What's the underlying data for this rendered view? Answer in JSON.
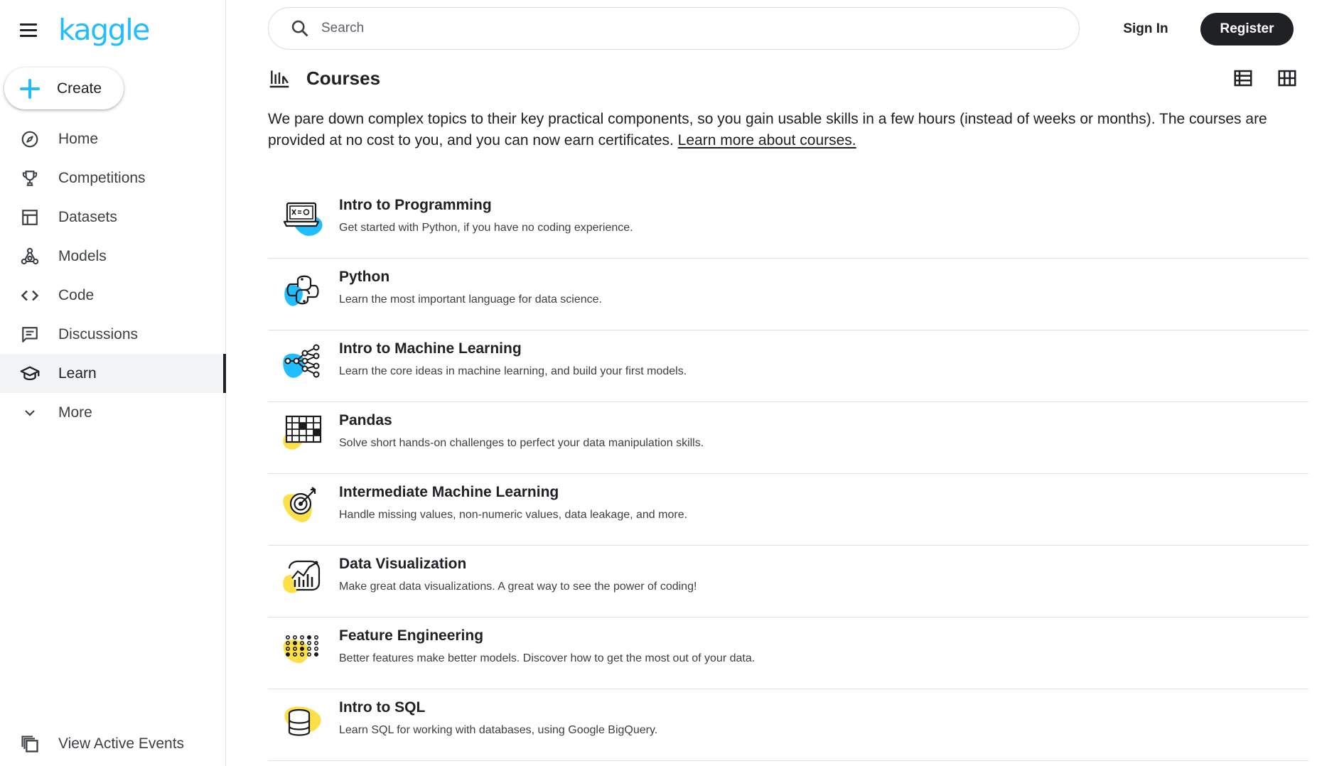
{
  "brand": {
    "logo": "kaggle",
    "accent": "#20beff"
  },
  "create": {
    "label": "Create"
  },
  "nav": {
    "items": [
      {
        "label": "Home",
        "icon": "compass-icon"
      },
      {
        "label": "Competitions",
        "icon": "trophy-icon"
      },
      {
        "label": "Datasets",
        "icon": "table-icon"
      },
      {
        "label": "Models",
        "icon": "models-icon"
      },
      {
        "label": "Code",
        "icon": "code-icon"
      },
      {
        "label": "Discussions",
        "icon": "discussions-icon"
      },
      {
        "label": "Learn",
        "icon": "school-icon",
        "active": true
      },
      {
        "label": "More",
        "icon": "chevron-down-icon"
      }
    ],
    "bottom": {
      "label": "View Active Events",
      "icon": "events-icon"
    }
  },
  "header": {
    "search_placeholder": "Search",
    "signin_label": "Sign In",
    "register_label": "Register"
  },
  "page": {
    "title": "Courses",
    "intro_text": "We pare down complex topics to their key practical components, so you gain usable skills in a few hours (instead of weeks or months). The courses are provided at no cost to you, and you can now earn certificates. ",
    "intro_link": "Learn more about courses."
  },
  "courses": [
    {
      "title": "Intro to Programming",
      "desc": "Get started with Python, if you have no coding experience.",
      "blob": "#20beff"
    },
    {
      "title": "Python",
      "desc": "Learn the most important language for data science.",
      "blob": "#20beff"
    },
    {
      "title": "Intro to Machine Learning",
      "desc": "Learn the core ideas in machine learning, and build your first models.",
      "blob": "#20beff"
    },
    {
      "title": "Pandas",
      "desc": "Solve short hands-on challenges to perfect your data manipulation skills.",
      "blob": "#fde047"
    },
    {
      "title": "Intermediate Machine Learning",
      "desc": "Handle missing values, non-numeric values, data leakage, and more.",
      "blob": "#fde047"
    },
    {
      "title": "Data Visualization",
      "desc": "Make great data visualizations. A great way to see the power of coding!",
      "blob": "#fde047"
    },
    {
      "title": "Feature Engineering",
      "desc": "Better features make better models. Discover how to get the most out of your data.",
      "blob": "#fde047"
    },
    {
      "title": "Intro to SQL",
      "desc": "Learn SQL for working with databases, using Google BigQuery.",
      "blob": "#fde047"
    }
  ]
}
